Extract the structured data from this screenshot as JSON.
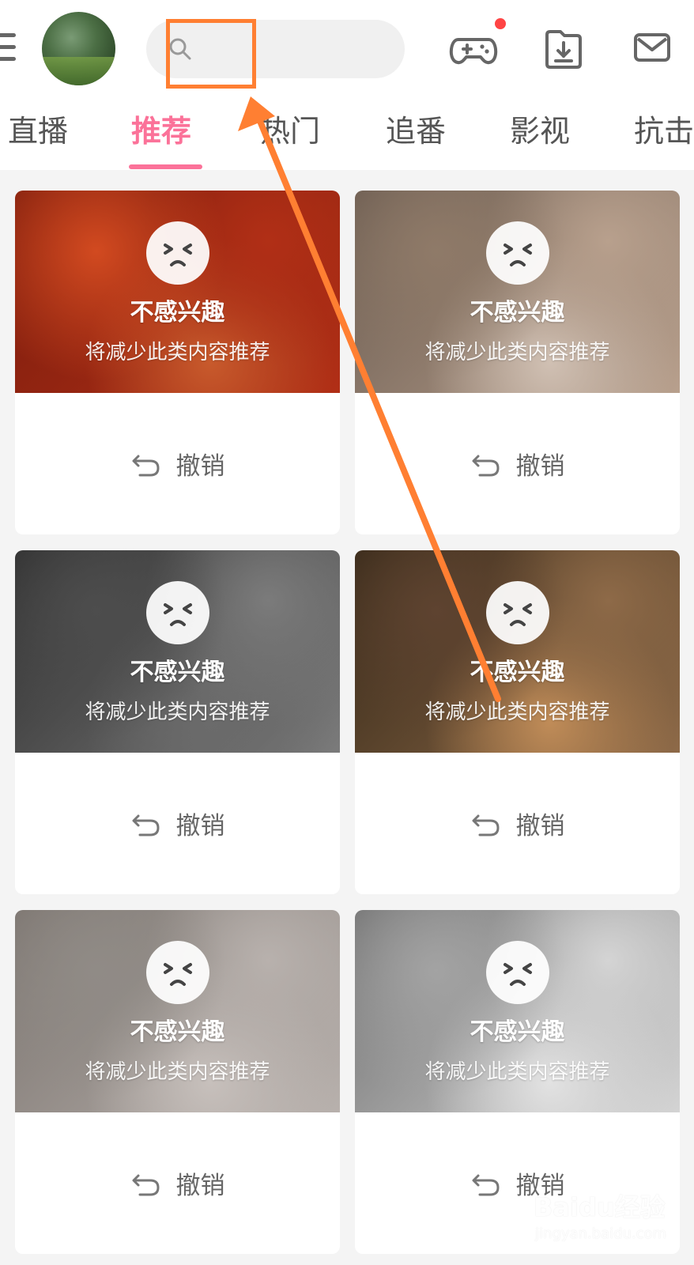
{
  "header": {
    "search_placeholder": "",
    "tabs": [
      "直播",
      "推荐",
      "热门",
      "追番",
      "影视",
      "抗击"
    ],
    "active_tab_index": 1
  },
  "cards": [
    {
      "title": "不感兴趣",
      "subtitle": "将减少此类内容推荐",
      "undo_label": "撤销",
      "thumb_colors": [
        "#d24a20",
        "#b12f16",
        "#7a1c0d",
        "#c85a2c"
      ]
    },
    {
      "title": "不感兴趣",
      "subtitle": "将减少此类内容推荐",
      "undo_label": "撤销",
      "thumb_colors": [
        "#8f7a68",
        "#b8a08d",
        "#6a5b50",
        "#d0c0b3"
      ]
    },
    {
      "title": "不感兴趣",
      "subtitle": "将减少此类内容推荐",
      "undo_label": "撤销",
      "thumb_colors": [
        "#4d4d4d",
        "#7b7b7b",
        "#2e2e2e",
        "#6b6b6b"
      ]
    },
    {
      "title": "不感兴趣",
      "subtitle": "将减少此类内容推荐",
      "undo_label": "撤销",
      "thumb_colors": [
        "#5e4330",
        "#8e6a48",
        "#352818",
        "#c08c58"
      ]
    },
    {
      "title": "不感兴趣",
      "subtitle": "将减少此类内容推荐",
      "undo_label": "撤销",
      "thumb_colors": [
        "#908b86",
        "#b8b1ad",
        "#7b746f",
        "#c7c0bc"
      ]
    },
    {
      "title": "不感兴趣",
      "subtitle": "将减少此类内容推荐",
      "undo_label": "撤销",
      "thumb_colors": [
        "#a3a3a3",
        "#d4d4d4",
        "#6f6f6f",
        "#e2e2e2"
      ]
    }
  ],
  "annotation": {
    "highlight_color": "#ff7f32"
  },
  "watermark": {
    "main": "Baidu经验",
    "sub": "jingyan.baidu.com"
  }
}
